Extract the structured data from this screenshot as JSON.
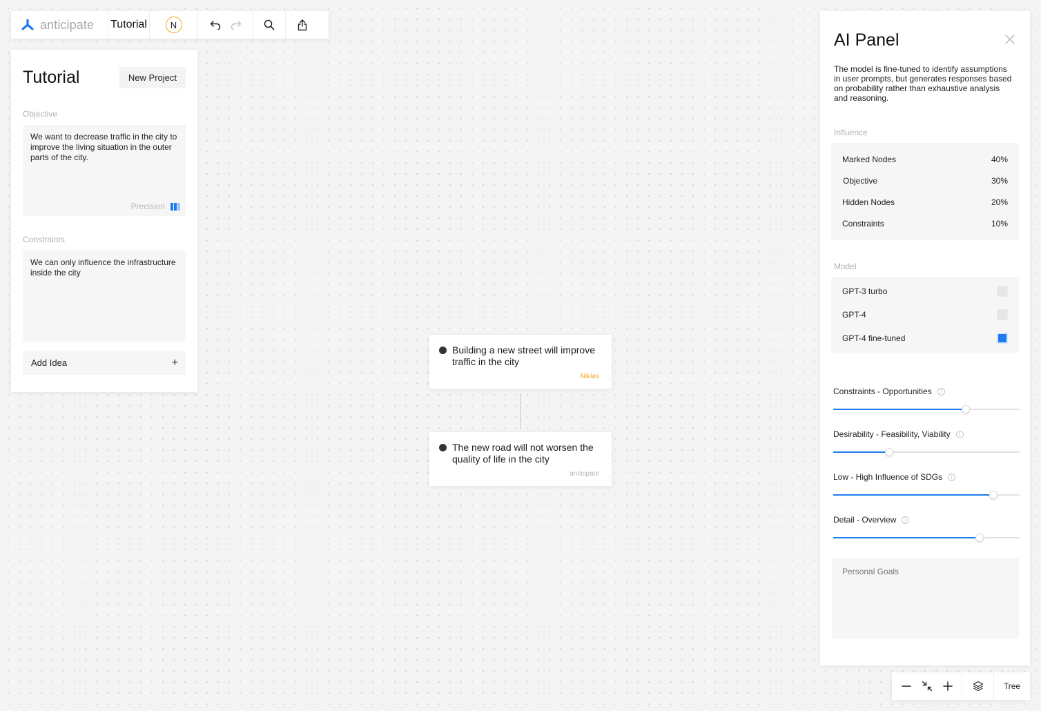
{
  "toolbar": {
    "brand": "anticipate",
    "project_title": "Tutorial",
    "avatar_initial": "N"
  },
  "left_panel": {
    "title": "Tutorial",
    "new_project_label": "New Project",
    "objective_label": "Objective",
    "objective_text": "We want to decrease traffic in the city to improve the living situation in the outer parts of the city.",
    "precision_label": "Precision",
    "precision_level": 2,
    "precision_max": 3,
    "constraints_label": "Constraints",
    "constraints_text": "We can only influence the infrastructure inside the city",
    "add_idea_label": "Add Idea",
    "add_idea_symbol": "+"
  },
  "nodes": [
    {
      "text": "Building a new street will improve traffic in the city",
      "author": "Niklas",
      "author_color": "#f5a623"
    },
    {
      "text": "The new road will not worsen the quality of life in the city",
      "author": "anticipate",
      "author_color": "#b5b5b5"
    }
  ],
  "ai_panel": {
    "title": "AI Panel",
    "description": "The model is fine-tuned to identify assumptions in user prompts, but generates responses based on probability rather than exhaustive analysis and reasoning.",
    "influence_label": "Influence",
    "influence": [
      {
        "name": "Marked Nodes",
        "value": "40%"
      },
      {
        "name": "Objective",
        "value": "30%"
      },
      {
        "name": "Hidden Nodes",
        "value": "20%"
      },
      {
        "name": "Constraints",
        "value": "10%"
      }
    ],
    "model_label": "Model",
    "models": [
      {
        "name": "GPT-3 turbo",
        "selected": false
      },
      {
        "name": "GPT-4",
        "selected": false
      },
      {
        "name": "GPT-4 fine-tuned",
        "selected": true
      }
    ],
    "sliders": [
      {
        "label": "Constraints - Opportunities",
        "value": 0.71
      },
      {
        "label": "Desirability - Feasibility, Viability",
        "value": 0.3
      },
      {
        "label": "Low - High Influence of SDGs",
        "value": 0.86
      },
      {
        "label": "Detail - Overview",
        "value": 0.785
      }
    ],
    "personal_goals_placeholder": "Personal Goals"
  },
  "bottom_bar": {
    "view_label": "Tree"
  },
  "colors": {
    "accent": "#1d7bf0",
    "accent_light": "#9cc4f7",
    "avatar_ring": "#f5a623"
  }
}
